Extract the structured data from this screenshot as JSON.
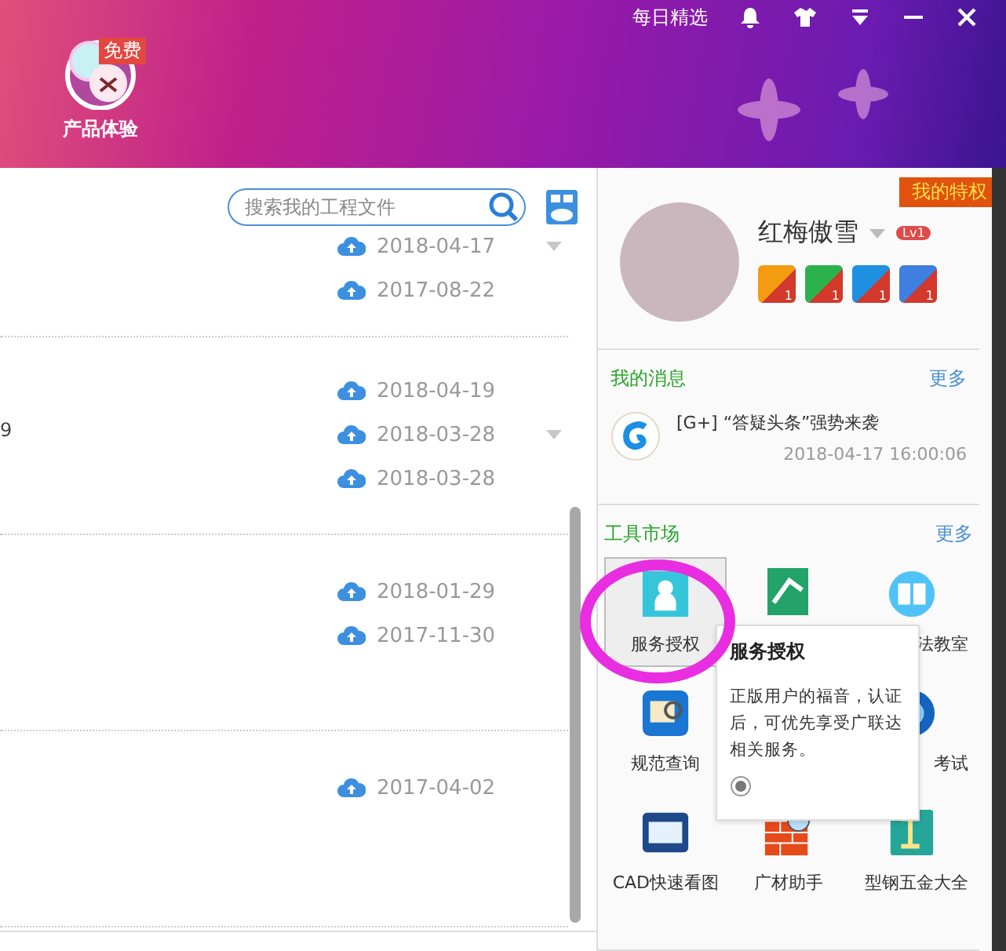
{
  "header": {
    "app": {
      "label": "产品体验",
      "badge": "免费"
    },
    "daily_pick": "每日精选"
  },
  "files": {
    "search": {
      "placeholder": "搜索我的工程文件"
    },
    "cut_text": "9",
    "groups": [
      {
        "dates": [
          {
            "text": "2018-04-17",
            "caret": true
          },
          {
            "text": "2017-08-22",
            "caret": false
          }
        ]
      },
      {
        "dates": [
          {
            "text": "2018-04-19",
            "caret": false
          },
          {
            "text": "2018-03-28",
            "caret": true
          },
          {
            "text": "2018-03-28",
            "caret": false
          }
        ]
      },
      {
        "dates": [
          {
            "text": "2018-01-29",
            "caret": false
          },
          {
            "text": "2017-11-30",
            "caret": false
          }
        ]
      },
      {
        "dates": [
          {
            "text": "2017-04-02",
            "caret": false
          }
        ]
      }
    ]
  },
  "profile": {
    "privilege": "我的特权",
    "name": "红梅傲雪",
    "level": "Lv1",
    "badges": [
      {
        "color": "#f39c12",
        "count": "1"
      },
      {
        "color": "#2bb24c",
        "count": "1"
      },
      {
        "color": "#1e8fe1",
        "count": "1"
      },
      {
        "color": "#3f7fe0",
        "count": "1"
      }
    ]
  },
  "messages": {
    "title": "我的消息",
    "more": "更多",
    "items": [
      {
        "text": "[G+]  “答疑头条”强势来袭",
        "time": "2018-04-17 16:00:06"
      }
    ]
  },
  "tools": {
    "title": "工具市场",
    "more": "更多",
    "items": [
      {
        "kind": "person",
        "label": "服务授权",
        "selected": true
      },
      {
        "kind": "book",
        "selected": false
      },
      {
        "kind": "open",
        "label": "法教室",
        "selected": false
      },
      {
        "kind": "search",
        "label": "规范查询",
        "selected": false
      },
      {
        "kind": "hidden"
      },
      {
        "kind": "disc",
        "label": "考试",
        "selected": false
      },
      {
        "kind": "cad",
        "label": "CAD快速看图",
        "selected": false
      },
      {
        "kind": "brick",
        "label": "广材助手",
        "selected": false
      },
      {
        "kind": "steel",
        "label": "型钢五金大全",
        "selected": false
      }
    ],
    "tooltip": {
      "title": "服务授权",
      "body": "正版用户的福音，认证后，可优先享受广联达相关服务。"
    }
  }
}
